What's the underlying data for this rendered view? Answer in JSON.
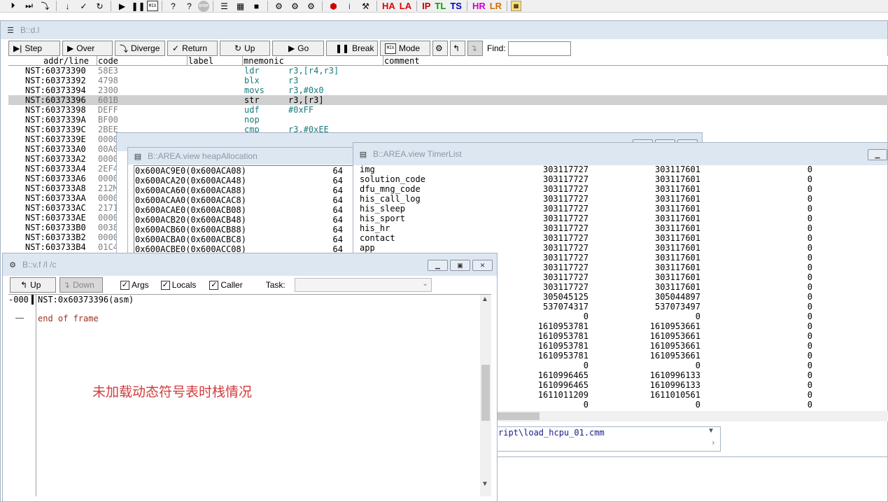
{
  "main_toolbar": {
    "icons": [
      "step-icon",
      "step-over-icon",
      "step-diverge-icon",
      "step-down-icon",
      "check-icon",
      "return-icon",
      "go-icon",
      "break-icon",
      "mode-icon",
      "help-icon",
      "context-help-icon",
      "stop-icon",
      "list-icon",
      "mixed-icon",
      "memory-icon",
      "trace-icon-1",
      "trace-icon-2",
      "trace-icon-3",
      "reset-icon",
      "info-icon",
      "tools-icon",
      "grid-icon"
    ],
    "mode_badge": "MIX",
    "stop_label": "STOP",
    "reg_labels": [
      {
        "text": "HA",
        "color": "#e00000"
      },
      {
        "text": "LA",
        "color": "#e00000"
      },
      {
        "text": "IP",
        "color": "#c00000"
      },
      {
        "text": "TL",
        "color": "#00a000"
      },
      {
        "text": "TS",
        "color": "#0000c0"
      },
      {
        "text": "HR",
        "color": "#d000d0"
      },
      {
        "text": "LR",
        "color": "#d07000"
      }
    ]
  },
  "list_window": {
    "title": "B::d.l",
    "buttons": {
      "step": "Step",
      "over": "Over",
      "diverge": "Diverge",
      "return": "Return",
      "up": "Up",
      "go": "Go",
      "break": "Break",
      "mode": "Mode",
      "mode_badge": "MIX"
    },
    "find_label": "Find:",
    "find_value": "",
    "columns": {
      "addr": "addr/line",
      "code": "code",
      "label": "label",
      "mnemonic": "mnemonic",
      "comment": "comment"
    },
    "rows": [
      {
        "addr": "NST:60373390",
        "code": "58E3",
        "mn": "ldr",
        "op": "r3,[r4,r3]"
      },
      {
        "addr": "NST:60373392",
        "code": "4798",
        "mn": "blx",
        "op": "r3"
      },
      {
        "addr": "NST:60373394",
        "code": "2300",
        "mn": "movs",
        "op": "r3,#0x0"
      },
      {
        "addr": "NST:60373396",
        "code": "601B",
        "mn": "str",
        "op": "r3,[r3]"
      },
      {
        "addr": "NST:60373398",
        "code": "DEFF",
        "mn": "udf",
        "op": "#0xFF"
      },
      {
        "addr": "NST:6037339A",
        "code": "BF00",
        "mn": "nop",
        "op": ""
      },
      {
        "addr": "NST:6037339C",
        "code": "2BEE",
        "mn": "cmp",
        "op": "r3,#0xEE"
      },
      {
        "addr": "NST:6037339E",
        "code": "0000",
        "mn": "",
        "op": ""
      },
      {
        "addr": "NST:603733A0",
        "code": "00A0",
        "mn": "",
        "op": ""
      },
      {
        "addr": "NST:603733A2",
        "code": "0000",
        "mn": "",
        "op": ""
      },
      {
        "addr": "NST:603733A4",
        "code": "2EF4",
        "mn": "",
        "op": ""
      },
      {
        "addr": "NST:603733A6",
        "code": "0000",
        "mn": "",
        "op": ""
      },
      {
        "addr": "NST:603733A8",
        "code": "212M",
        "mn": "",
        "op": ""
      },
      {
        "addr": "NST:603733AA",
        "code": "0000",
        "mn": "",
        "op": ""
      },
      {
        "addr": "NST:603733AC",
        "code": "2171",
        "mn": "",
        "op": ""
      },
      {
        "addr": "NST:603733AE",
        "code": "0000",
        "mn": "",
        "op": ""
      },
      {
        "addr": "NST:603733B0",
        "code": "0038",
        "mn": "",
        "op": ""
      },
      {
        "addr": "NST:603733B2",
        "code": "0000",
        "mn": "",
        "op": ""
      },
      {
        "addr": "NST:603733B4",
        "code": "01C4",
        "mn": "",
        "op": ""
      }
    ]
  },
  "heap_window": {
    "title": "B::AREA.view heapAllocation",
    "rows": [
      {
        "addr": "0x600AC9E0(0x600ACA08)",
        "size": "64"
      },
      {
        "addr": "0x600ACA20(0x600ACA48)",
        "size": "64"
      },
      {
        "addr": "0x600ACA60(0x600ACA88)",
        "size": "64"
      },
      {
        "addr": "0x600ACAA0(0x600ACAC8)",
        "size": "64"
      },
      {
        "addr": "0x600ACAE0(0x600ACB08)",
        "size": "64"
      },
      {
        "addr": "0x600ACB20(0x600ACB48)",
        "size": "64"
      },
      {
        "addr": "0x600ACB60(0x600ACB88)",
        "size": "64"
      },
      {
        "addr": "0x600ACBA0(0x600ACBC8)",
        "size": "64"
      },
      {
        "addr": "0x600ACBE0(0x600ACC08)",
        "size": "64"
      }
    ]
  },
  "timer_window": {
    "title": "B::AREA.view TimerList",
    "rows": [
      {
        "name": "img",
        "a": "303117727",
        "b": "303117601",
        "c": "0"
      },
      {
        "name": "solution_code",
        "a": "303117727",
        "b": "303117601",
        "c": "0"
      },
      {
        "name": "dfu_mng_code",
        "a": "303117727",
        "b": "303117601",
        "c": "0"
      },
      {
        "name": "his_call_log",
        "a": "303117727",
        "b": "303117601",
        "c": "0"
      },
      {
        "name": "his_sleep",
        "a": "303117727",
        "b": "303117601",
        "c": "0"
      },
      {
        "name": "his_sport",
        "a": "303117727",
        "b": "303117601",
        "c": "0"
      },
      {
        "name": "his_hr",
        "a": "303117727",
        "b": "303117601",
        "c": "0"
      },
      {
        "name": "contact",
        "a": "303117727",
        "b": "303117601",
        "c": "0"
      },
      {
        "name": "app",
        "a": "303117727",
        "b": "303117601",
        "c": "0"
      },
      {
        "name": "",
        "a": "303117727",
        "b": "303117601",
        "c": "0"
      },
      {
        "name": "",
        "a": "303117727",
        "b": "303117601",
        "c": "0"
      },
      {
        "name": "",
        "a": "303117727",
        "b": "303117601",
        "c": "0"
      },
      {
        "name": "",
        "a": "303117727",
        "b": "303117601",
        "c": "0"
      },
      {
        "name": "",
        "a": "305045125",
        "b": "305044897",
        "c": "0"
      },
      {
        "name": "",
        "a": "537074317",
        "b": "537073497",
        "c": "0"
      },
      {
        "name": "",
        "a": "0",
        "b": "0",
        "c": "0"
      },
      {
        "name": "",
        "a": "1610953781",
        "b": "1610953661",
        "c": "0"
      },
      {
        "name": "",
        "a": "1610953781",
        "b": "1610953661",
        "c": "0"
      },
      {
        "name": "",
        "a": "1610953781",
        "b": "1610953661",
        "c": "0"
      },
      {
        "name": "",
        "a": "1610953781",
        "b": "1610953661",
        "c": "0"
      },
      {
        "name": "",
        "a": "0",
        "b": "0",
        "c": "0"
      },
      {
        "name": "",
        "a": "1610996465",
        "b": "1610996133",
        "c": "0"
      },
      {
        "name": "",
        "a": "1610996465",
        "b": "1610996133",
        "c": "0"
      },
      {
        "name": "",
        "a": "1611011209",
        "b": "1611010561",
        "c": "0"
      },
      {
        "name": "",
        "a": "0",
        "b": "0",
        "c": "0"
      }
    ]
  },
  "script_path": "ript\\load_hcpu_01.cmm",
  "frame_window": {
    "title": "B::v.f /l /c",
    "buttons": {
      "up": "Up",
      "down": "Down"
    },
    "checks": {
      "args": "Args",
      "locals": "Locals",
      "caller": "Caller"
    },
    "task_label": "Task:",
    "task_value": "",
    "frame_index": "-000",
    "frame_text": "NST:0x60373396(asm)",
    "end_gutter": "——",
    "end_text": "end of frame"
  },
  "annotation": "未加载动态符号表时栈情况",
  "colors": {
    "titlebar_bg": "#dde7f2",
    "teal_mnemonic": "#1a7a7a",
    "annotation_red": "#d23b3b",
    "end_of_frame": "#a03020"
  }
}
